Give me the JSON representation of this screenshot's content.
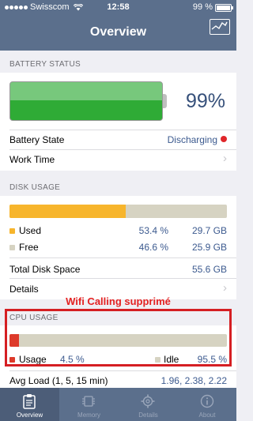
{
  "status_bar": {
    "carrier": "Swisscom",
    "time": "12:58",
    "battery_percent": "99 %"
  },
  "nav": {
    "title": "Overview",
    "chart_icon": "line-chart-icon"
  },
  "battery_status": {
    "header": "BATTERY STATUS",
    "level_percent": 99,
    "level_label": "99%",
    "state_label": "Battery State",
    "state_value": "Discharging",
    "work_time_label": "Work Time"
  },
  "disk_usage": {
    "header": "DISK USAGE",
    "used_fraction": 0.534,
    "used_label": "Used",
    "used_percent": "53.4 %",
    "used_size": "29.7 GB",
    "free_label": "Free",
    "free_percent": "46.6 %",
    "free_size": "25.9 GB",
    "total_label": "Total Disk Space",
    "total_value": "55.6 GB",
    "details_label": "Details"
  },
  "annotation": {
    "text": "Wifi Calling supprimé"
  },
  "cpu_usage": {
    "header": "CPU USAGE",
    "usage_fraction": 0.045,
    "usage_label": "Usage",
    "usage_value": "4.5 %",
    "idle_label": "Idle",
    "idle_value": "95.5 %",
    "avg_load_label": "Avg Load (1, 5, 15 min)",
    "avg_load_value": "1.96, 2.38, 2.22"
  },
  "colors": {
    "nav": "#5b6f8c",
    "battery_green": "#2fab36",
    "disk_used": "#f7b52c",
    "cpu_usage": "#dd3a2a",
    "value_blue": "#3c5a8f",
    "annotation_red": "#d51f23"
  },
  "tabs": [
    {
      "label": "Overview",
      "icon": "clipboard-icon",
      "active": true
    },
    {
      "label": "Memory",
      "icon": "memory-chip-icon",
      "active": false
    },
    {
      "label": "Details",
      "icon": "gear-icon",
      "active": false
    },
    {
      "label": "About",
      "icon": "info-icon",
      "active": false
    }
  ]
}
